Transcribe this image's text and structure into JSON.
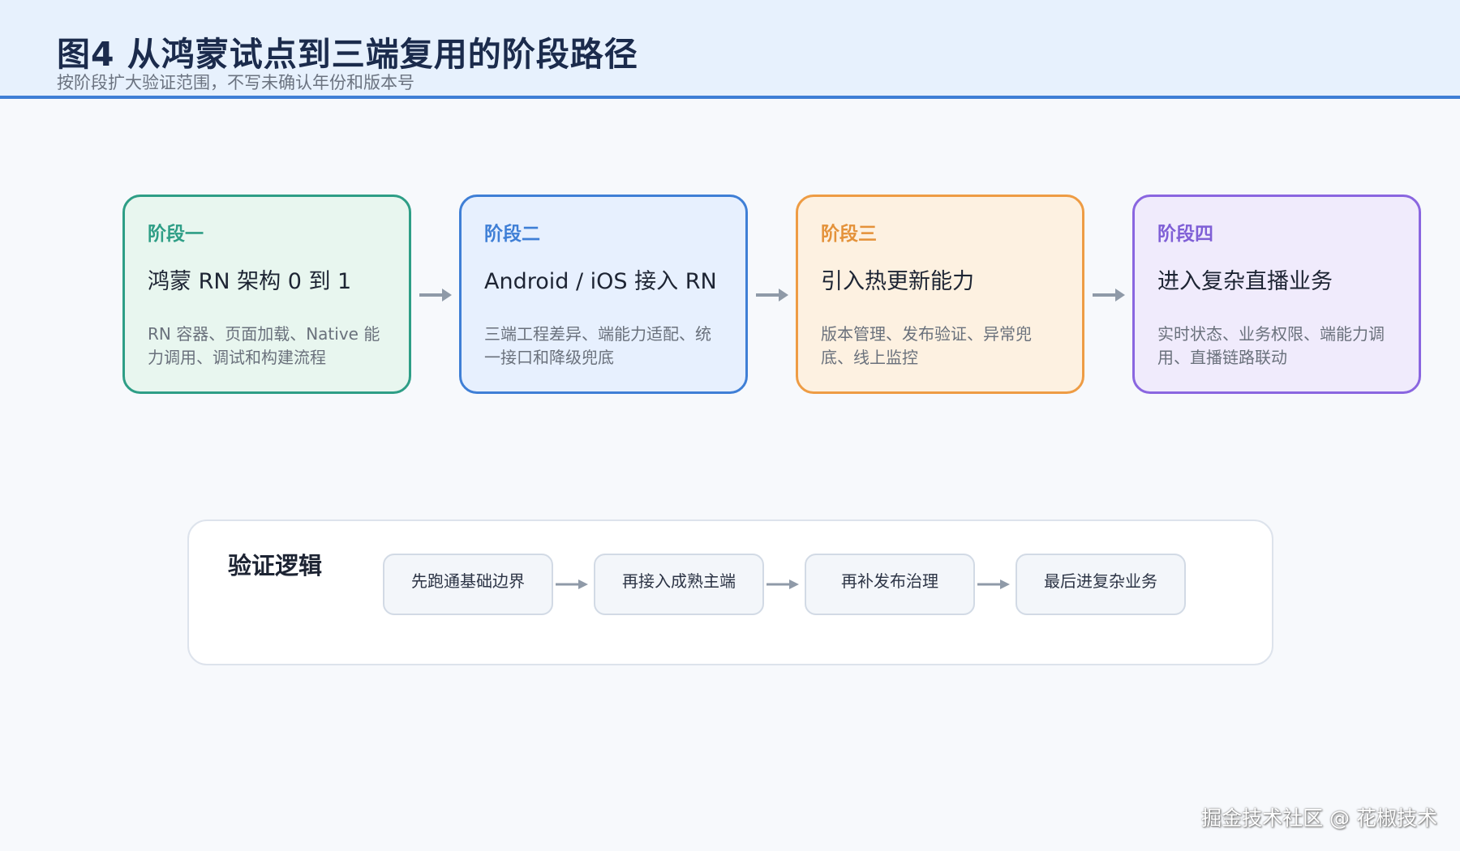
{
  "header": {
    "title": "图4  从鸿蒙试点到三端复用的阶段路径",
    "subtitle": "按阶段扩大验证范围，不写未确认年份和版本号"
  },
  "stages": [
    {
      "label": "阶段一",
      "title": "鸿蒙 RN 架构 0 到 1",
      "desc": "RN 容器、页面加载、Native 能力调用、调试和构建流程"
    },
    {
      "label": "阶段二",
      "title": "Android / iOS 接入 RN",
      "desc": "三端工程差异、端能力适配、统一接口和降级兜底"
    },
    {
      "label": "阶段三",
      "title": "引入热更新能力",
      "desc": "版本管理、发布验证、异常兜底、线上监控"
    },
    {
      "label": "阶段四",
      "title": "进入复杂直播业务",
      "desc": "实时状态、业务权限、端能力调用、直播链路联动"
    }
  ],
  "logic": {
    "heading": "验证逻辑",
    "steps": [
      "先跑通基础边界",
      "再接入成熟主端",
      "再补发布治理",
      "最后进复杂业务"
    ]
  },
  "watermark": "掘金技术社区 @ 花椒技术",
  "colors": {
    "stage1": "#2e9e86",
    "stage2": "#3f7fd6",
    "stage3": "#ee9c44",
    "stage4": "#8a66e0",
    "arrow": "#8f9aa8",
    "header_rule": "#3f7fd6"
  }
}
